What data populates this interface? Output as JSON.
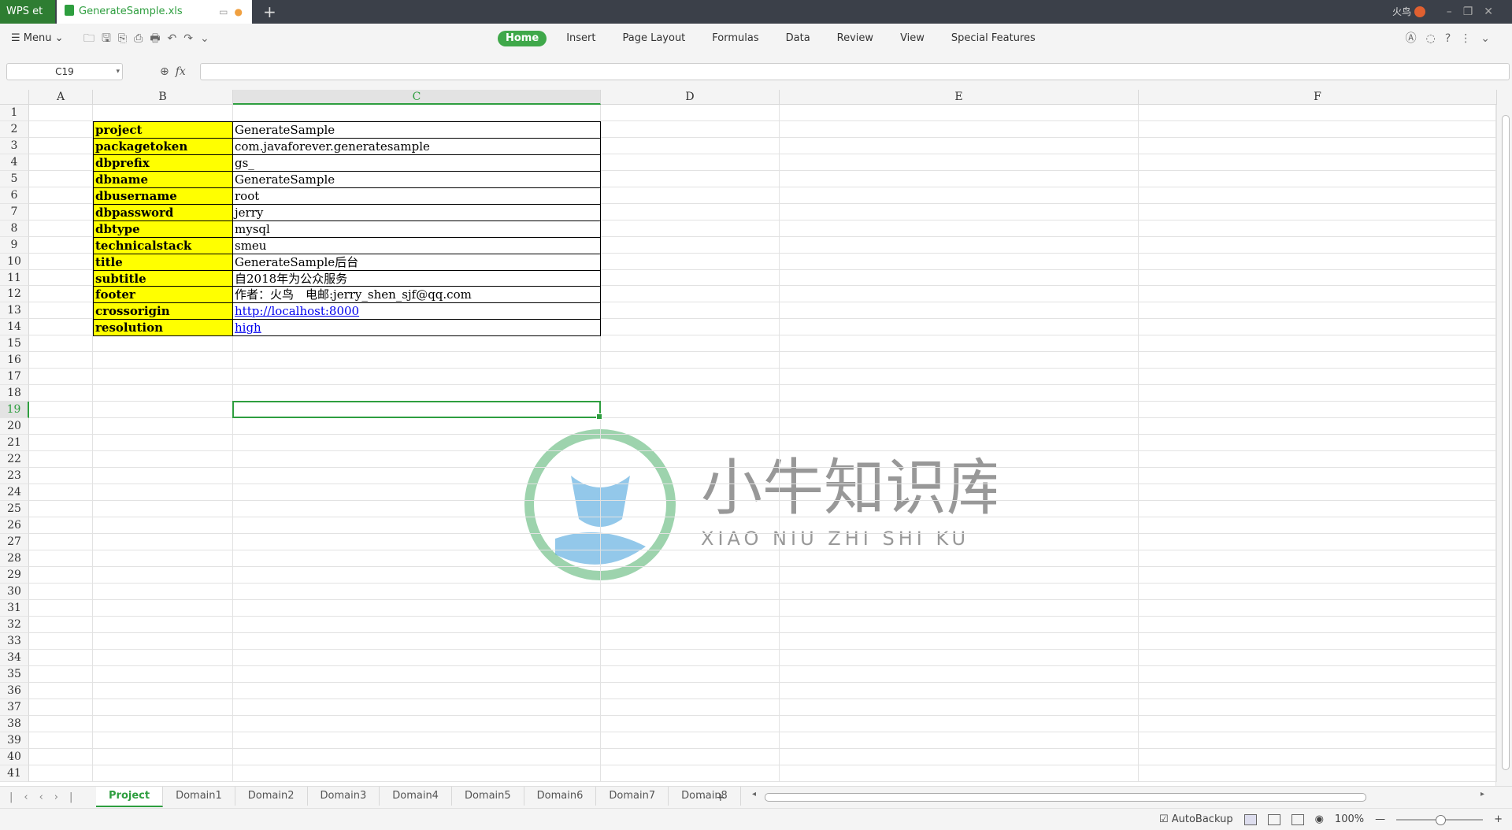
{
  "titlebar": {
    "app_name": "WPS et",
    "doc_tab": "GenerateSample.xls",
    "new_tab": "+",
    "user_name": "火鸟",
    "window_controls": "–❐✕"
  },
  "toolbar": {
    "menu_label": "Menu",
    "quick_icons": "🗀🖫⎘⎙🖶↶↷⌄",
    "ribbon_tabs": [
      "Home",
      "Insert",
      "Page Layout",
      "Formulas",
      "Data",
      "Review",
      "View",
      "Special Features"
    ],
    "active_tab": "Home",
    "right_tools": "Ⓐ◌?⋮⌄"
  },
  "formula_bar": {
    "name_box": "C19",
    "fx_label": "fx",
    "zoom_icon": "⊕",
    "formula_value": ""
  },
  "columns": [
    "A",
    "B",
    "C",
    "D",
    "E",
    "F"
  ],
  "selected_column": "C",
  "rows": [
    "1",
    "2",
    "3",
    "4",
    "5",
    "6",
    "7",
    "8",
    "9",
    "10",
    "11",
    "12",
    "13",
    "14",
    "15",
    "16",
    "17",
    "18",
    "19",
    "20",
    "21",
    "22",
    "23",
    "24",
    "25",
    "26",
    "27",
    "28",
    "29",
    "30",
    "31",
    "32",
    "33",
    "34",
    "35",
    "36",
    "37",
    "38",
    "39",
    "40",
    "41"
  ],
  "selected_row": "19",
  "selected_cell": "C19",
  "table": [
    {
      "key": "project",
      "value": "GenerateSample"
    },
    {
      "key": "packagetoken",
      "value": "com.javaforever.generatesample"
    },
    {
      "key": "dbprefix",
      "value": "gs_"
    },
    {
      "key": "dbname",
      "value": "GenerateSample"
    },
    {
      "key": "dbusername",
      "value": "root"
    },
    {
      "key": "dbpassword",
      "value": "jerry"
    },
    {
      "key": "dbtype",
      "value": "mysql"
    },
    {
      "key": "technicalstack",
      "value": "smeu"
    },
    {
      "key": "title",
      "value": "GenerateSample后台"
    },
    {
      "key": "subtitle",
      "value": "自2018年为公众服务"
    },
    {
      "key": "footer",
      "value": "作者：火鸟　电邮:jerry_shen_sjf@qq.com"
    },
    {
      "key": "crossorigin",
      "value": "http://localhost:8000",
      "link": true
    },
    {
      "key": "resolution",
      "value": "high",
      "link": true
    }
  ],
  "watermark": {
    "title": "小牛知识库",
    "subtitle": "XIAO NIU ZHI SHI KU"
  },
  "sheets": [
    "Project",
    "Domain1",
    "Domain2",
    "Domain3",
    "Domain4",
    "Domain5",
    "Domain6",
    "Domain7",
    "Domain8"
  ],
  "active_sheet": "Project",
  "sheet_nav": "|‹‹›|",
  "sheet_more": "⋯+",
  "status": {
    "autobackup": "AutoBackup",
    "zoom": "100%",
    "zoom_out": "—",
    "zoom_in": "+"
  },
  "colors": {
    "accent": "#2e9e3f",
    "key_fill": "#ffff00",
    "link": "#0000ee"
  }
}
